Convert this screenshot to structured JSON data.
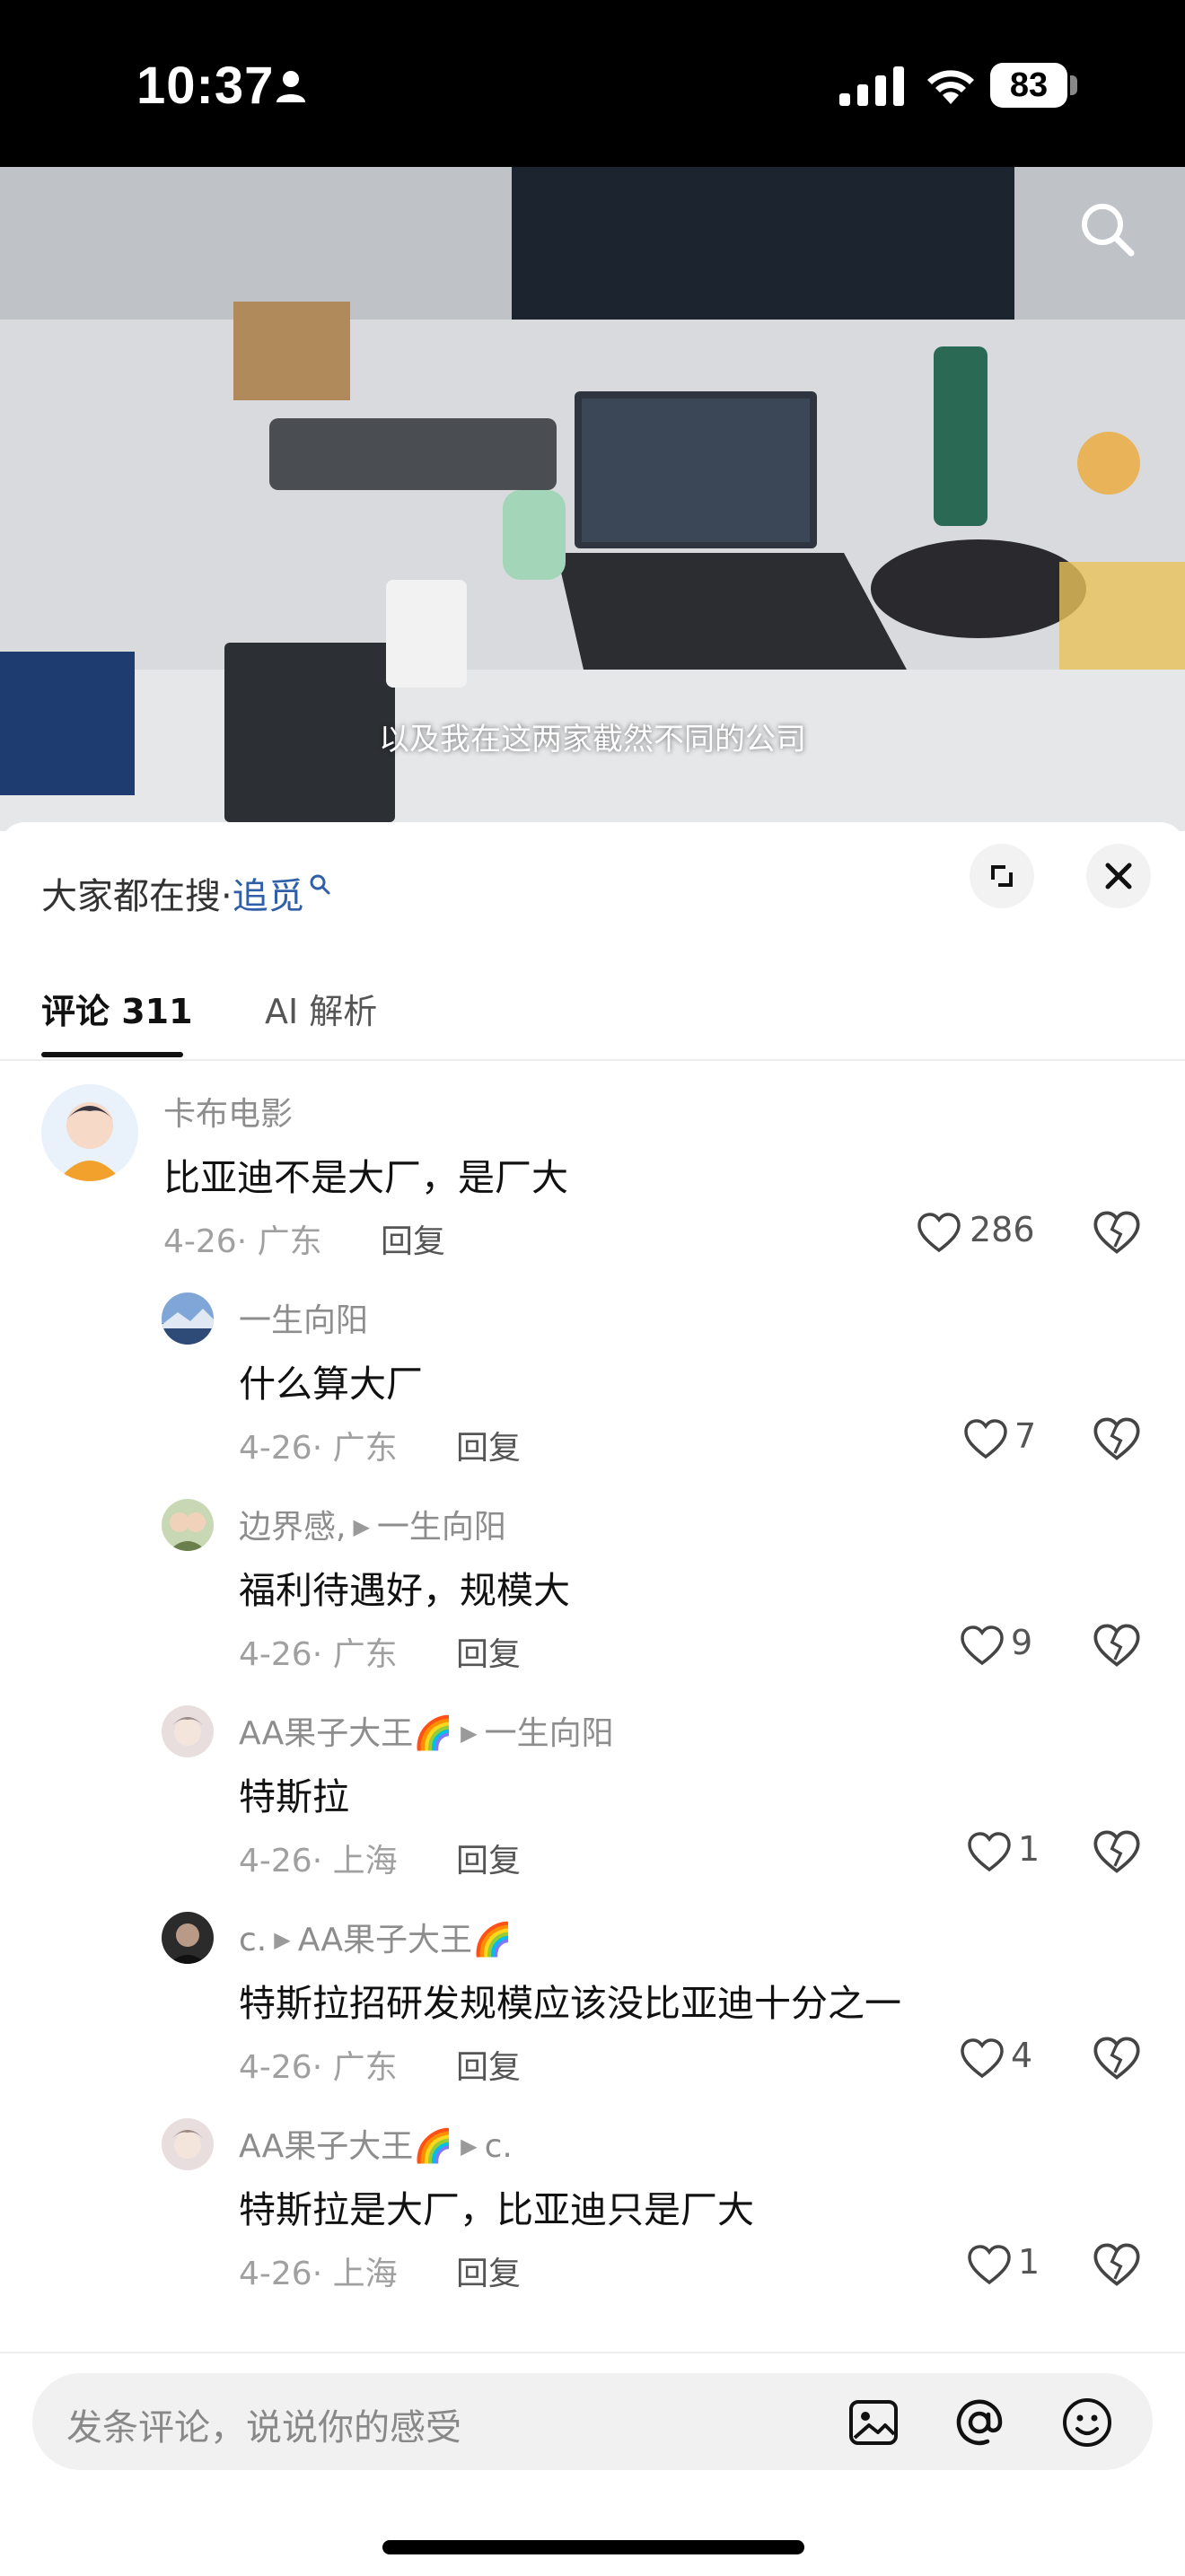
{
  "status_bar": {
    "time": "10:37",
    "battery": "83"
  },
  "video": {
    "subtitle": "以及我在这两家截然不同的公司"
  },
  "sheet": {
    "hot_search_prefix": "大家都在搜·",
    "hot_search_keyword": "追觅",
    "tabs": [
      {
        "label": "评论 311",
        "active": true
      },
      {
        "label": "AI 解析",
        "active": false
      }
    ]
  },
  "comments": [
    {
      "name": "卡布电影",
      "reply_to": "",
      "text": "比亚迪不是大厂，是厂大",
      "date": "4-26",
      "location": "广东",
      "reply_label": "回复",
      "likes": "286"
    },
    {
      "name": "一生向阳",
      "reply_to": "",
      "text": "什么算大厂",
      "date": "4-26",
      "location": "广东",
      "reply_label": "回复",
      "likes": "7"
    },
    {
      "name": "边界感,",
      "reply_to": "一生向阳",
      "text": "福利待遇好，规模大",
      "date": "4-26",
      "location": "广东",
      "reply_label": "回复",
      "likes": "9"
    },
    {
      "name": "AA果子大王🌈",
      "reply_to": "一生向阳",
      "text": "特斯拉",
      "date": "4-26",
      "location": "上海",
      "reply_label": "回复",
      "likes": "1"
    },
    {
      "name": "c.",
      "reply_to": "AA果子大王🌈",
      "text": "特斯拉招研发规模应该没比亚迪十分之一",
      "date": "4-26",
      "location": "广东",
      "reply_label": "回复",
      "likes": "4"
    },
    {
      "name": "AA果子大王🌈",
      "reply_to": "c.",
      "text": "特斯拉是大厂，比亚迪只是厂大",
      "date": "4-26",
      "location": "上海",
      "reply_label": "回复",
      "likes": "1"
    }
  ],
  "input_bar": {
    "placeholder": "发条评论，说说你的感受"
  },
  "colors": {
    "link_blue": "#2f5fa8",
    "meta_gray": "#a0a0a0"
  }
}
